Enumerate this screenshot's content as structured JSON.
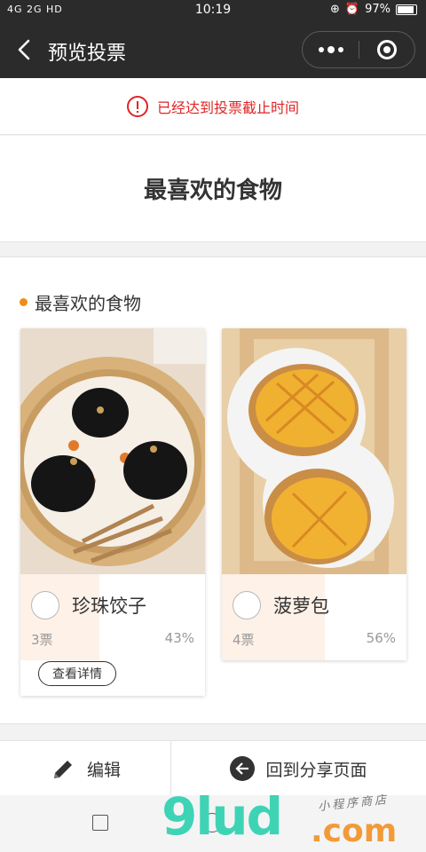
{
  "status_bar": {
    "network": "4G 2G HD",
    "time": "10:19",
    "battery_percent": "97%",
    "battery_level": 0.97
  },
  "nav": {
    "title": "预览投票",
    "back_icon": "back-arrow-icon",
    "more_icon": "more-dots-icon",
    "close_icon": "miniprogram-close-icon"
  },
  "notice": {
    "text": "已经达到投票截止时间",
    "icon": "warning-circle-icon",
    "color": "#e02424"
  },
  "poll": {
    "title": "最喜欢的食物"
  },
  "section": {
    "title": "最喜欢的食物",
    "accent_color": "#f08c1a",
    "options": [
      {
        "name": "珍珠饺子",
        "votes": "3票",
        "percent": "43%",
        "share": 0.43,
        "detail_label": "查看详情"
      },
      {
        "name": "菠萝包",
        "votes": "4票",
        "percent": "56%",
        "share": 0.56
      }
    ]
  },
  "bottom_bar": {
    "edit_label": "编辑",
    "edit_icon": "pencil-icon",
    "share_label": "回到分享页面",
    "share_icon": "back-circle-icon"
  },
  "watermark": {
    "brand": "9lud",
    "suffix": ".com",
    "tagline": "小程序商店"
  }
}
